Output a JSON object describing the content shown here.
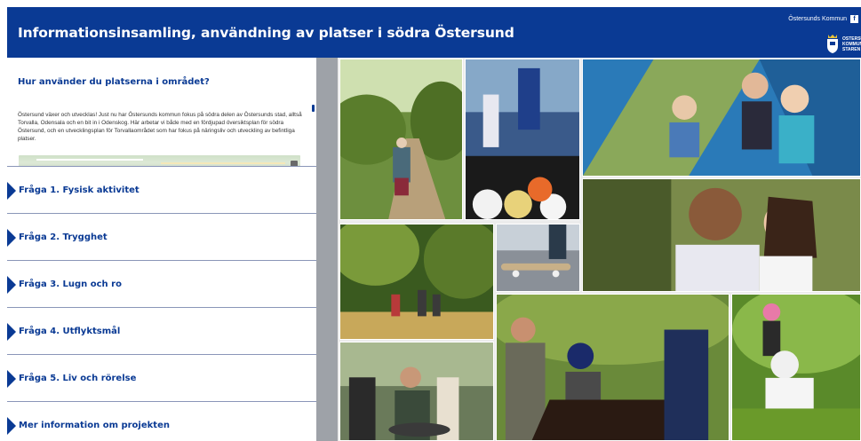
{
  "header": {
    "title": "Informationsinsamling, användning av platser i södra Östersund",
    "kommun_link": "Östersunds Kommun",
    "facebook_icon": "facebook-icon",
    "logo_text_1": "ÖSTERSUNDS",
    "logo_text_2": "KOMMUN",
    "logo_text_3": "STAREN",
    "background_color": "#0a3a94"
  },
  "intro": {
    "heading": "Hur använder du platserna i området?",
    "body": "Östersund växer och utvecklas! Just nu har Östersunds kommun fokus på södra delen av Östersunds stad, alltså Torvalla, Odensala och en bit in i Odenskog. Här arbetar vi både med en fördjupad översiktsplan för södra Östersund, och en utvecklingsplan för Torvallaområdet som har fokus på näringsliv och utveckling av befintliga platser."
  },
  "accordion": [
    {
      "label": "Fråga 1. Fysisk aktivitet"
    },
    {
      "label": "Fråga 2. Trygghet"
    },
    {
      "label": "Fråga 3. Lugn och ro"
    },
    {
      "label": "Fråga 4. Utflyktsmål"
    },
    {
      "label": "Fråga 5. Liv och rörelse"
    },
    {
      "label": "Mer information om projekten"
    }
  ],
  "colors": {
    "accent": "#0a3a94",
    "divider": "#8a96b8",
    "gutter": "#9ea2a8"
  }
}
